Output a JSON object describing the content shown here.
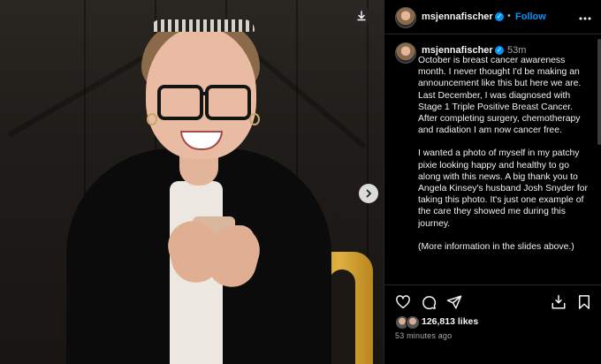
{
  "post": {
    "username": "msjennafischer",
    "follow_label": "Follow",
    "separator": "•",
    "time_ago_short": "53m",
    "caption_paragraphs": [
      "October is breast cancer awareness month. I never thought I'd be making an announcement like this but here we are. Last December, I was diagnosed with Stage 1 Triple Positive Breast Cancer. After completing surgery, chemotherapy and radiation I am now cancer free.",
      "I wanted a photo of myself in my patchy pixie looking happy and healthy to go along with this news. A big thank you to Angela Kinsey's husband Josh Snyder for taking this photo. It's just one example of the care they showed me during this journey.",
      "(More information in the slides above.)"
    ],
    "likes": "126,813 likes",
    "time_ago_long": "53 minutes ago"
  },
  "colors": {
    "background": "#000000",
    "link_blue": "#0095f6",
    "muted_text": "#a8a8a8"
  },
  "icons": [
    "download-icon",
    "chevron-right-icon",
    "more-horizontal-icon",
    "verified-badge-icon",
    "heart-icon",
    "comment-icon",
    "share-icon",
    "save-to-collection-icon",
    "bookmark-icon"
  ]
}
